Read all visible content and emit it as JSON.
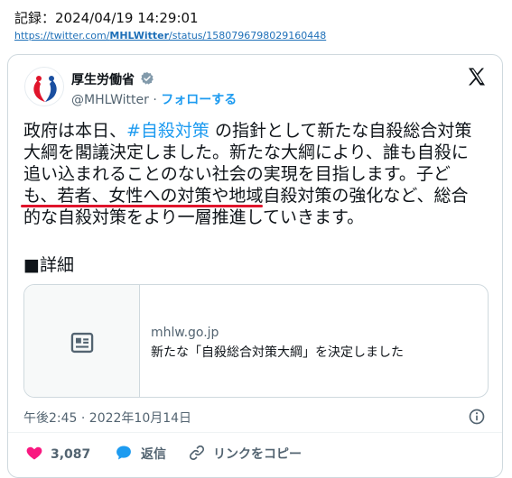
{
  "record": {
    "label": "記録：2024/04/19 14:29:01",
    "url_prefix": "https://twitter.com/",
    "url_account": "MHLWitter",
    "url_suffix": "/status/1580796798029160448"
  },
  "tweet": {
    "display_name": "厚生労働省",
    "handle": "@MHLWitter",
    "separator": " · ",
    "follow_label": "フォローする",
    "text_before": "政府は本日、",
    "hashtag": "#自殺対策",
    "text_after": " の指針として新たな自殺総合対策大綱を閣議決定しました。新たな大綱により、誰も自殺に追い込まれることのない社会の実現を目指します。子ども、若者、女性への対策や地域自殺対策の強化など、総合的な自殺対策をより一層推進していきます。",
    "detail": "■詳細",
    "link_card": {
      "domain": "mhlw.go.jp",
      "title": "新たな「自殺総合対策大綱」を決定しました"
    },
    "timestamp": "午後2:45 · 2022年10月14日",
    "actions": {
      "like_count": "3,087",
      "reply_label": "返信",
      "copy_link_label": "リンクをコピー"
    }
  },
  "colors": {
    "accent": "#1d9bf0",
    "like": "#f91880",
    "underline": "#e0142b"
  },
  "icons": [
    "verified-badge-icon",
    "x-logo-icon",
    "news-article-icon",
    "info-icon",
    "heart-icon",
    "reply-bubble-icon",
    "link-icon"
  ]
}
